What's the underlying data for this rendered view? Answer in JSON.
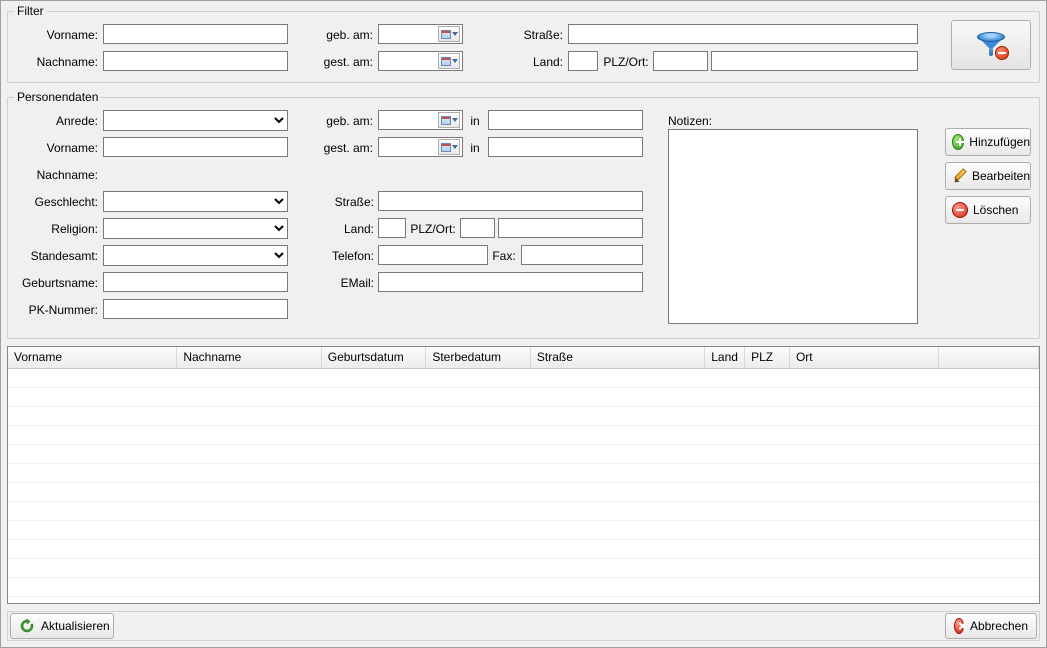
{
  "filter": {
    "title": "Filter",
    "vorname_label": "Vorname:",
    "nachname_label": "Nachname:",
    "geb_am_label": "geb. am:",
    "gest_am_label": "gest. am:",
    "strasse_label": "Straße:",
    "land_label": "Land:",
    "plzort_label": "PLZ/Ort:",
    "vorname": "",
    "nachname": "",
    "geb_am": "",
    "gest_am": "",
    "strasse": "",
    "land": "",
    "plz": "",
    "ort": ""
  },
  "personendaten": {
    "title": "Personendaten",
    "anrede_label": "Anrede:",
    "vorname_label": "Vorname:",
    "nachname_label": "Nachname:",
    "geschlecht_label": "Geschlecht:",
    "religion_label": "Religion:",
    "standesamt_label": "Standesamt:",
    "geburtsname_label": "Geburtsname:",
    "pknummer_label": "PK-Nummer:",
    "geb_am_label": "geb. am:",
    "gest_am_label": "gest. am:",
    "in_label": "in",
    "strasse_label": "Straße:",
    "land_label": "Land:",
    "plzort_label": "PLZ/Ort:",
    "telefon_label": "Telefon:",
    "fax_label": "Fax:",
    "email_label": "EMail:",
    "notizen_label": "Notizen:",
    "anrede": "",
    "vorname": "",
    "nachname": "",
    "geschlecht": "",
    "religion": "",
    "standesamt": "",
    "geburtsname": "",
    "pknummer": "",
    "geb_am": "",
    "geb_in": "",
    "gest_am": "",
    "gest_in": "",
    "strasse": "",
    "land": "",
    "plz": "",
    "ort": "",
    "telefon": "",
    "fax": "",
    "email": "",
    "notizen": ""
  },
  "buttons": {
    "hinzufuegen": "Hinzufügen",
    "bearbeiten": "Bearbeiten",
    "loeschen": "Löschen",
    "aktualisieren": "Aktualisieren",
    "abbrechen": "Abbrechen"
  },
  "grid": {
    "columns": [
      {
        "key": "vorname",
        "label": "Vorname",
        "width": 170
      },
      {
        "key": "nachname",
        "label": "Nachname",
        "width": 145
      },
      {
        "key": "geburtsdatum",
        "label": "Geburtsdatum",
        "width": 105
      },
      {
        "key": "sterbedatum",
        "label": "Sterbedatum",
        "width": 105
      },
      {
        "key": "strasse",
        "label": "Straße",
        "width": 175
      },
      {
        "key": "land",
        "label": "Land",
        "width": 40
      },
      {
        "key": "plz",
        "label": "PLZ",
        "width": 45
      },
      {
        "key": "ort",
        "label": "Ort",
        "width": 150
      },
      {
        "key": "extra",
        "label": "",
        "width": 100
      }
    ],
    "rows": []
  }
}
